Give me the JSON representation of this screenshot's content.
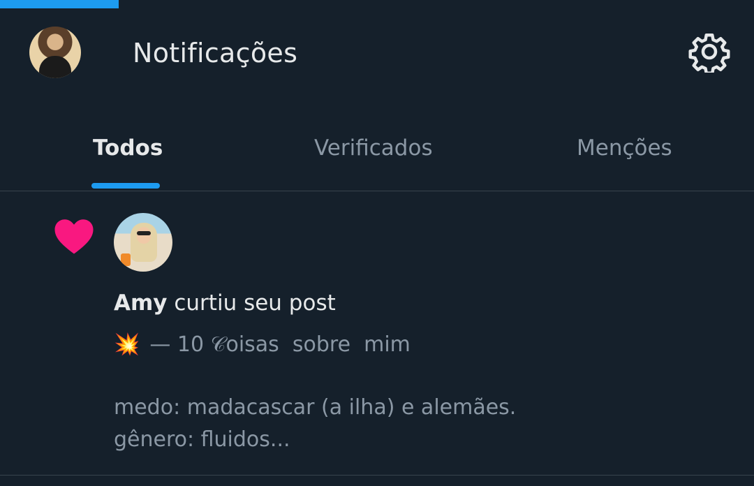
{
  "progress": {
    "fraction": 0.157
  },
  "header": {
    "title": "Notificações",
    "settings_icon": "gear-icon"
  },
  "tabs": [
    {
      "label": "Todos",
      "active": true
    },
    {
      "label": "Verificados",
      "active": false
    },
    {
      "label": "Menções",
      "active": false
    }
  ],
  "notification": {
    "type_icon": "heart-icon",
    "user_name": "Amy",
    "action": " curtiu seu post",
    "snippet_emoji": "💥",
    "snippet_title": "— 10 𝒞oisas  sobre  mim",
    "body_line_1": "medo: madacascar (a ilha) e alemães.",
    "body_line_2": "gênero: fluidos..."
  },
  "colors": {
    "background": "#15202b",
    "accent": "#1d9bf0",
    "like": "#f91880",
    "muted_text": "#8b98a5",
    "primary_text": "#e7e9ea",
    "divider": "#38444d"
  }
}
